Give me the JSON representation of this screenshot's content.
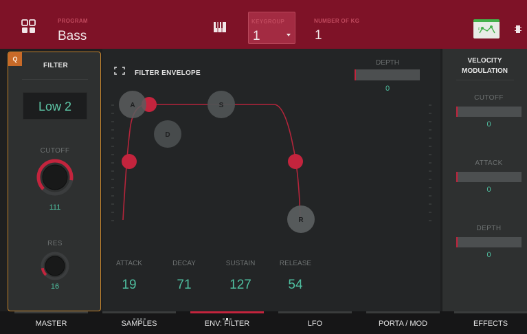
{
  "header": {
    "program_label": "PROGRAM",
    "program_value": "Bass",
    "keygroup_label": "KEYGROUP",
    "keygroup_value": "1",
    "num_kg_label": "NUMBER OF KG",
    "num_kg_value": "1",
    "icons": [
      "grid-icon",
      "piano-keys-icon",
      "envelope-view-icon",
      "menu-icon"
    ]
  },
  "filter_panel": {
    "badge": "Q",
    "title": "FILTER",
    "type_value": "Low 2",
    "cutoff_label": "CUTOFF",
    "cutoff_value": "111",
    "cutoff_level": 0.87,
    "res_label": "RES",
    "res_value": "16",
    "res_level": 0.13
  },
  "envelope": {
    "title": "FILTER ENVELOPE",
    "handles": [
      "A",
      "D",
      "S",
      "R"
    ],
    "columns": [
      {
        "label": "ATTACK",
        "value": "19"
      },
      {
        "label": "DECAY",
        "value": "71"
      },
      {
        "label": "SUSTAIN",
        "value": "127"
      },
      {
        "label": "RELEASE",
        "value": "54"
      }
    ],
    "depth_label": "DEPTH",
    "depth_value": "0"
  },
  "velocity_panel": {
    "title": "VELOCITY MODULATION",
    "items": [
      {
        "label": "CUTOFF",
        "value": "0"
      },
      {
        "label": "ATTACK",
        "value": "0"
      },
      {
        "label": "DEPTH",
        "value": "0"
      }
    ]
  },
  "tabs": [
    {
      "label": "MASTER",
      "active": false
    },
    {
      "label": "SAMPLES",
      "active": false
    },
    {
      "label": "ENV: FILTER",
      "active": true
    },
    {
      "label": "LFO",
      "active": false
    },
    {
      "label": "PORTA / MOD",
      "active": false
    },
    {
      "label": "EFFECTS",
      "active": false
    }
  ],
  "colors": {
    "header_bg": "#7e1227",
    "accent_red": "#c3243d",
    "teal_value": "#4fbfa0",
    "panel_border": "#c4842d"
  }
}
